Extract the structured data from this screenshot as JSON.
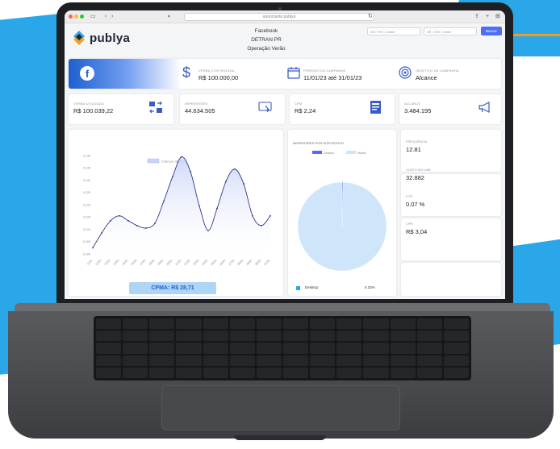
{
  "browser": {
    "url": "anunciante.publya",
    "colors": {
      "close": "#ff5f57",
      "minimize": "#febc2e",
      "maximize": "#28c840"
    }
  },
  "brand": {
    "name": "publya"
  },
  "header": {
    "line1": "Facebook",
    "line2": "DETRAN PR",
    "line3": "Operação Verão"
  },
  "filters": {
    "start_placeholder": "dd / mm / aaaa",
    "end_placeholder": "dd / mm / aaaa",
    "search_label": "Buscar"
  },
  "campaign": {
    "platform_icon": "facebook-icon",
    "budget_label": "VERBA CONTRATADA",
    "budget_value": "R$ 100.000,00",
    "period_label": "PERÍODO DA CAMPANHA",
    "period_value": "11/01/23 até 31/01/23",
    "objective_label": "OBJETIVO DA CAMPANHA",
    "objective_value": "Alcance"
  },
  "kpis": [
    {
      "label": "VERBA UTILIZADA",
      "value": "R$ 100.039,22",
      "icon": "money-transfer-icon"
    },
    {
      "label": "IMPRESSÕES",
      "value": "44.634.505",
      "icon": "click-icon"
    },
    {
      "label": "CPM",
      "value": "R$ 2,24",
      "icon": "document-icon"
    },
    {
      "label": "ALCANCE",
      "value": "3.484.195",
      "icon": "megaphone-icon"
    }
  ],
  "line_chart": {
    "legend": "Custo por objetivo",
    "button": "CPMA: R$ 28,71"
  },
  "pie_chart": {
    "title": "IMPRESSÕES POR DISPOSITIVO",
    "legend": [
      "Desktop",
      "Mobile"
    ],
    "table_row_label": "Desktop",
    "table_row_value": "0.33%"
  },
  "side_metrics": [
    {
      "label": "FREQUÊNCIA",
      "value": "12.81"
    },
    {
      "label": "CUSTO NO LINK",
      "value": "32.882"
    },
    {
      "label": "CTR",
      "value": "0.07 %"
    },
    {
      "label": "CPR",
      "value": "R$ 3,04"
    }
  ],
  "chart_data": [
    {
      "type": "area",
      "legend": [
        "Custo por objetivo"
      ],
      "ylim": [
        0.1,
        0.14
      ],
      "yticks": [
        "0.100",
        "0.105",
        "0.110",
        "0.115",
        "0.120",
        "0.125",
        "0.130",
        "0.135",
        "0.140"
      ],
      "x": [
        "11/01",
        "12/01",
        "13/01",
        "14/01",
        "15/01",
        "16/01",
        "17/01",
        "18/01",
        "19/01",
        "20/01",
        "21/01",
        "22/01",
        "23/01",
        "24/01",
        "25/01",
        "26/01",
        "27/01",
        "28/01",
        "29/01",
        "30/01",
        "31/01"
      ],
      "series": [
        {
          "name": "Custo por objetivo",
          "color": "#2d3a8c",
          "values": [
            0.1025,
            0.1085,
            0.1135,
            0.1155,
            0.1135,
            0.1115,
            0.1105,
            0.1125,
            0.1215,
            0.1315,
            0.1395,
            0.1335,
            0.1195,
            0.1095,
            0.1185,
            0.1295,
            0.1345,
            0.1285,
            0.1155,
            0.1115,
            0.1155
          ]
        }
      ]
    },
    {
      "type": "pie",
      "title": "IMPRESSÕES POR DISPOSITIVO",
      "labels": [
        "Desktop",
        "Mobile"
      ],
      "values": [
        0.33,
        99.67
      ],
      "colors": [
        "#4f6df5",
        "#cfe6fa"
      ]
    }
  ]
}
